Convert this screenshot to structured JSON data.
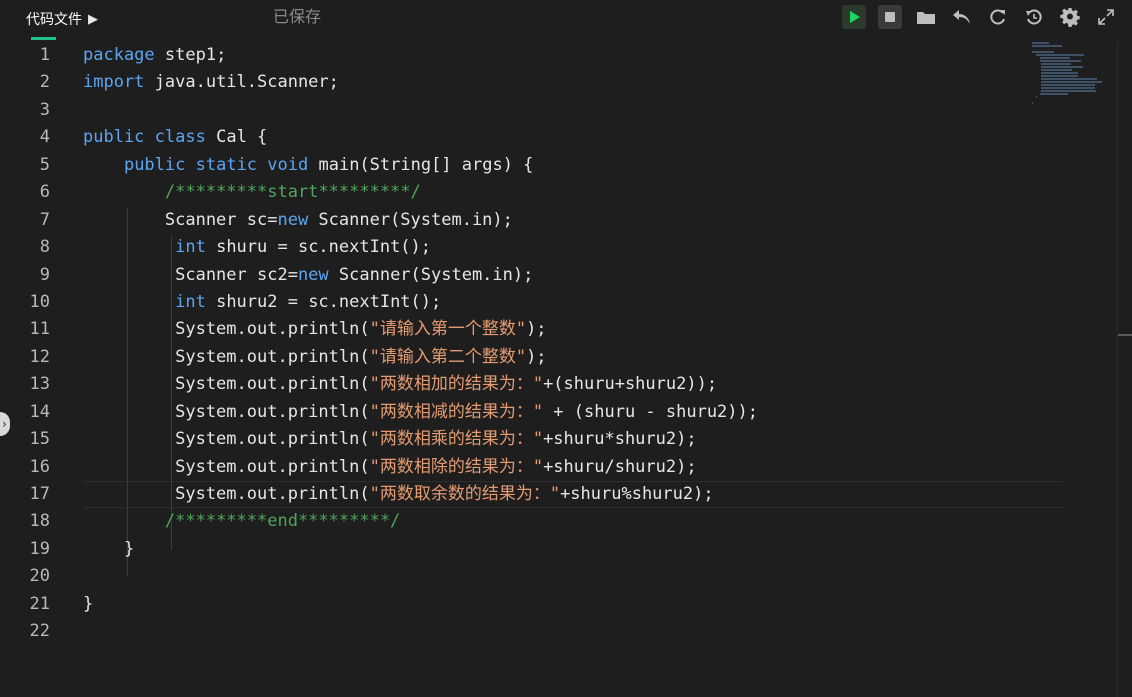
{
  "tab": {
    "label": "代码文件",
    "arrow": "▶"
  },
  "status": {
    "saved": "已保存"
  },
  "toolbar": {
    "buttons": [
      {
        "name": "run-button",
        "icon": "play-icon"
      },
      {
        "name": "stop-button",
        "icon": "stop-icon"
      },
      {
        "name": "folder-button",
        "icon": "folder-icon"
      },
      {
        "name": "undo-button",
        "icon": "undo-icon"
      },
      {
        "name": "refresh-button",
        "icon": "refresh-icon"
      },
      {
        "name": "history-button",
        "icon": "history-icon"
      },
      {
        "name": "settings-button",
        "icon": "gear-icon"
      },
      {
        "name": "fullscreen-button",
        "icon": "expand-icon"
      }
    ]
  },
  "colors": {
    "background": "#1e1e1e",
    "keyword": "#5aa5f2",
    "comment": "#4ea65a",
    "string": "#e49b71",
    "accent": "#1ec48b"
  },
  "editor": {
    "line_numbers": [
      "1",
      "2",
      "3",
      "4",
      "5",
      "6",
      "7",
      "8",
      "9",
      "10",
      "11",
      "12",
      "13",
      "14",
      "15",
      "16",
      "17",
      "18",
      "19",
      "20",
      "21",
      "22"
    ],
    "lines": [
      "package step1;",
      "import java.util.Scanner;",
      "",
      "public class Cal {",
      "    public static void main(String[] args) {",
      "        /*********start*********/",
      "        Scanner sc=new Scanner(System.in);",
      "         int shuru = sc.nextInt();",
      "         Scanner sc2=new Scanner(System.in);",
      "         int shuru2 = sc.nextInt();",
      "         System.out.println(\"请输入第一个整数\");",
      "         System.out.println(\"请输入第二个整数\");",
      "         System.out.println(\"两数相加的结果为：\"+(shuru+shuru2));",
      "         System.out.println(\"两数相减的结果为：\" + (shuru - shuru2));",
      "         System.out.println(\"两数相乘的结果为：\"+shuru*shuru2);",
      "         System.out.println(\"两数相除的结果为：\"+shuru/shuru2);",
      "         System.out.println(\"两数取余数的结果为：\"+shuru%shuru2);",
      "        /*********end*********/",
      "    }",
      "",
      "}",
      ""
    ],
    "current_line": 17
  }
}
